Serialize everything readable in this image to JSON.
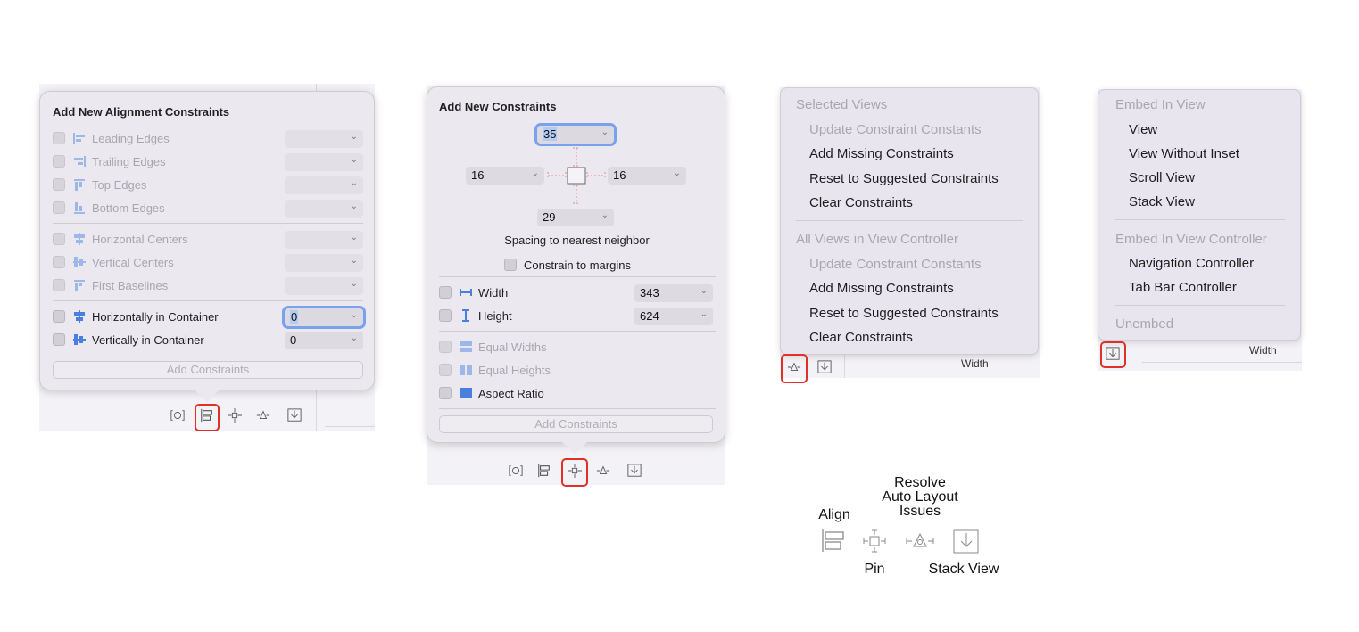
{
  "align_panel": {
    "title": "Add New Alignment Constraints",
    "edges": [
      {
        "label": "Leading Edges",
        "value": ""
      },
      {
        "label": "Trailing Edges",
        "value": ""
      },
      {
        "label": "Top Edges",
        "value": ""
      },
      {
        "label": "Bottom Edges",
        "value": ""
      }
    ],
    "centers": [
      {
        "label": "Horizontal Centers",
        "value": ""
      },
      {
        "label": "Vertical Centers",
        "value": ""
      },
      {
        "label": "First Baselines",
        "value": ""
      }
    ],
    "container": [
      {
        "label": "Horizontally in Container",
        "value": "0"
      },
      {
        "label": "Vertically in Container",
        "value": "0"
      }
    ],
    "add_button": "Add Constraints"
  },
  "pin_panel": {
    "title": "Add New Constraints",
    "top": "35",
    "left": "16",
    "right": "16",
    "bottom": "29",
    "spacing_label": "Spacing to nearest neighbor",
    "constrain_margins": "Constrain to margins",
    "width_label": "Width",
    "width_value": "343",
    "height_label": "Height",
    "height_value": "624",
    "equal_widths": "Equal Widths",
    "equal_heights": "Equal Heights",
    "aspect_ratio": "Aspect Ratio",
    "add_button": "Add Constraints"
  },
  "resolve_menu": {
    "selected_header": "Selected Views",
    "selected_items": [
      "Update Constraint Constants",
      "Add Missing Constraints",
      "Reset to Suggested Constraints",
      "Clear Constraints"
    ],
    "all_header": "All Views in View Controller",
    "all_items": [
      "Update Constraint Constants",
      "Add Missing Constraints",
      "Reset to Suggested Constraints",
      "Clear Constraints"
    ],
    "bg_label": "Width"
  },
  "embed_menu": {
    "view_header": "Embed In View",
    "view_items": [
      "View",
      "View Without Inset",
      "Scroll View",
      "Stack View"
    ],
    "controller_header": "Embed In View Controller",
    "controller_items": [
      "Navigation Controller",
      "Tab Bar Controller"
    ],
    "unembed": "Unembed",
    "bg_label": "Width"
  },
  "legend": {
    "align": "Align",
    "resolve": "Resolve\nAuto Layout\nIssues",
    "resolve_lines": [
      "Resolve",
      "Auto Layout",
      "Issues"
    ],
    "pin": "Pin",
    "stack": "Stack View"
  },
  "colors": {
    "accent": "#4a7fe0",
    "highlight": "#e0302a",
    "focus": "#78a2ee"
  }
}
